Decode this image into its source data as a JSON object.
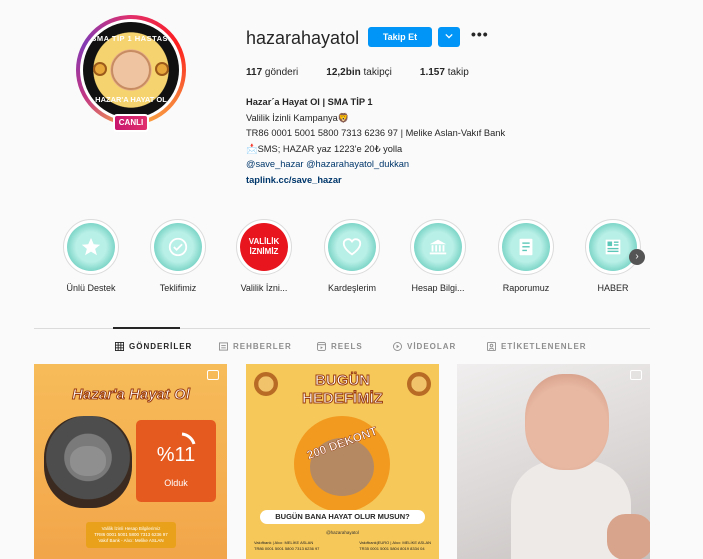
{
  "profile": {
    "avatar_text_top": "SMA TİP 1 HASTASI",
    "avatar_text_bottom": "HAZAR'A HAYAT OL",
    "live_label": "CANLI",
    "username": "hazarahayatol",
    "follow_label": "Takip Et",
    "dropdown_glyph": "⌄",
    "more_glyph": "•••"
  },
  "stats": {
    "posts_count": "117",
    "posts_label": "gönderi",
    "followers_count": "12,2bin",
    "followers_label": "takipçi",
    "following_count": "1.157",
    "following_label": "takip"
  },
  "bio": {
    "name": "Hazar´a Hayat Ol | SMA TİP 1",
    "line1": "Valilik İzinli Kampanya🦁",
    "line2": "TR86 0001 5001 5800 7313 6236 97 | Melike Aslan-Vakıf Bank",
    "line3": "📩SMS; HAZAR yaz 1223'e 20₺ yolla",
    "mention1": "@save_hazar",
    "mention2": "@hazarahayatol_dukkan",
    "link": "taplink.cc/save_hazar"
  },
  "highlights": [
    {
      "label": "Ünlü Destek",
      "icon": "star-icon"
    },
    {
      "label": "Teklifimiz",
      "icon": "badge-check-icon"
    },
    {
      "label": "Valilik İzni...",
      "icon": "valilik-badge",
      "badge_line1": "VALİLİK",
      "badge_line2": "İZNİMİZ"
    },
    {
      "label": "Kardeşlerim",
      "icon": "heart-icon"
    },
    {
      "label": "Hesap Bilgi...",
      "icon": "bank-icon"
    },
    {
      "label": "Raporumuz",
      "icon": "report-icon"
    },
    {
      "label": "HABER",
      "icon": "newspaper-icon"
    }
  ],
  "highlights_next_glyph": "›",
  "tabs": [
    {
      "label": "GÖNDERİLER",
      "icon": "grid-icon",
      "active": true
    },
    {
      "label": "REHBERLER",
      "icon": "guide-icon",
      "active": false
    },
    {
      "label": "REELS",
      "icon": "reels-icon",
      "active": false
    },
    {
      "label": "VİDEOLAR",
      "icon": "video-icon",
      "active": false
    },
    {
      "label": "ETİKETLENENLER",
      "icon": "tag-icon",
      "active": false
    }
  ],
  "posts": {
    "p1": {
      "title": "Hazar'a Hayat Ol",
      "percent": "%11",
      "status": "Olduk",
      "bottom_line1": "Valilik İzinli Hesap Bilgilerimiz",
      "bottom_line2": "TR86 0001 5001 5800 7313 6236 97",
      "bottom_line3": "Vakıf Bank - Alıcı: Melike ASLAN"
    },
    "p2": {
      "title_line1": "BUGÜN",
      "title_line2": "HEDEFİMİZ",
      "ribbon": "200 DEKONT",
      "question": "BUGÜN BANA HAYAT OLUR MUSUN?",
      "handle": "@hazarahayatol",
      "bank_left_line1": "Vakıfbank | Alıcı: MELİKE ASLAN",
      "bank_left_line2": "TR86 0001 5001 5800 7313 6236 97",
      "bank_right_line1": "Vakıfbank|EURO | Alıcı: MELİKE ASLAN",
      "bank_right_line2": "TR35 0001 5001 5804 8019 8334 04"
    }
  }
}
